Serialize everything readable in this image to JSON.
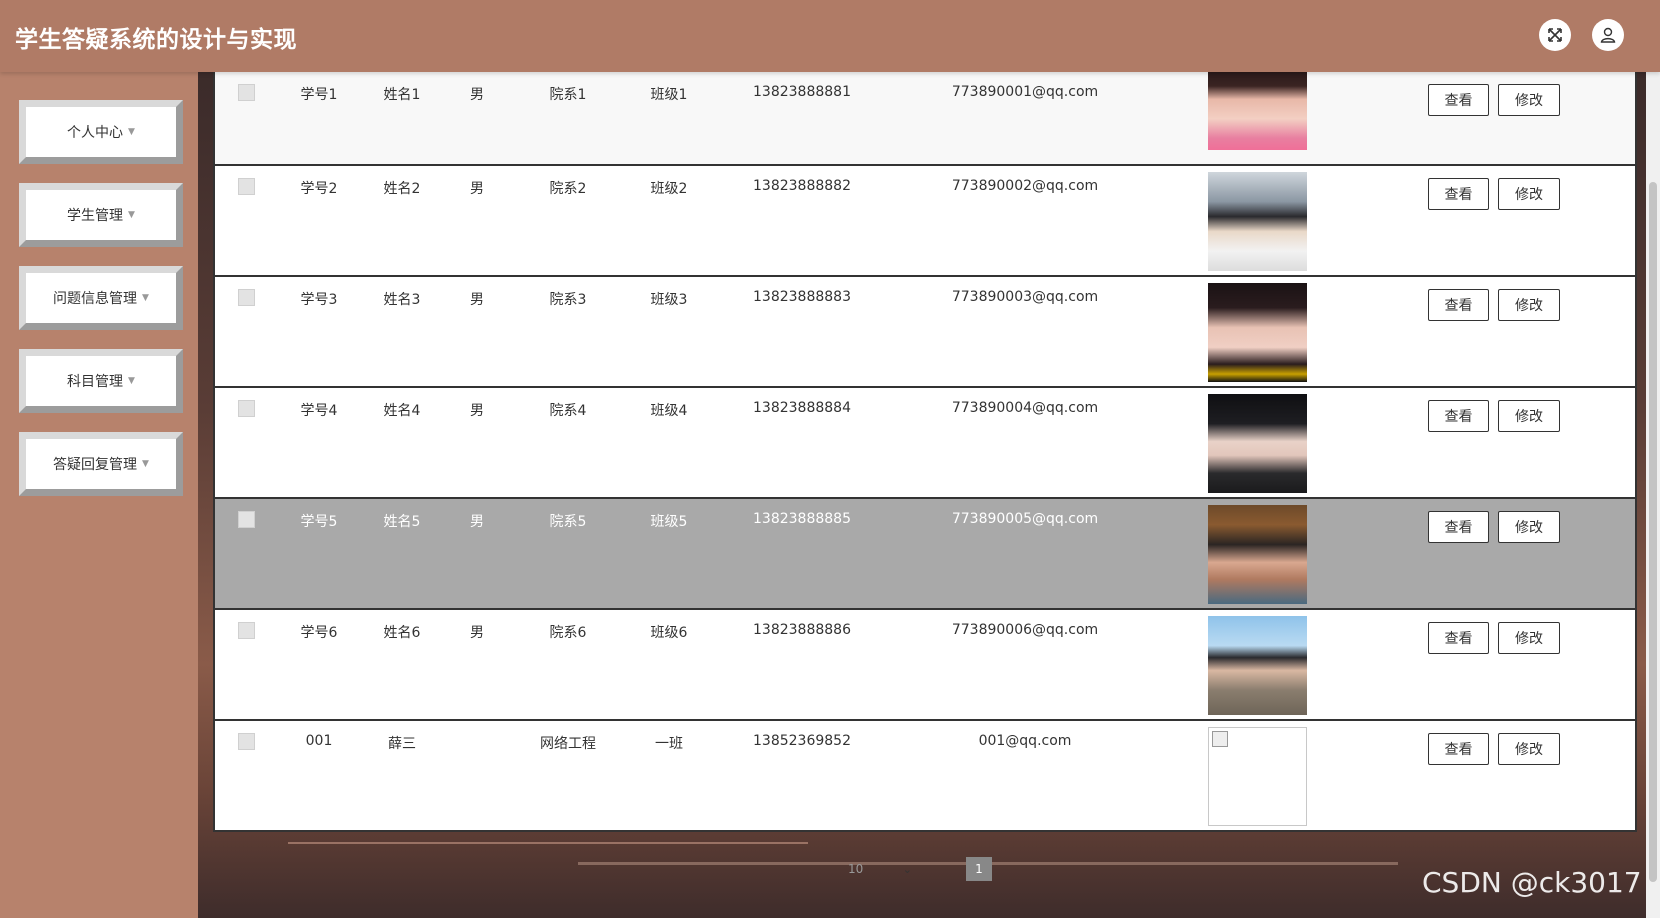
{
  "header": {
    "title": "学生答疑系统的设计与实现",
    "icons": [
      "fullscreen-icon",
      "user-icon"
    ]
  },
  "sidebar": {
    "items": [
      {
        "label": "个人中心"
      },
      {
        "label": "学生管理"
      },
      {
        "label": "问题信息管理"
      },
      {
        "label": "科目管理"
      },
      {
        "label": "答疑回复管理"
      }
    ]
  },
  "table": {
    "rows": [
      {
        "id": "学号1",
        "name": "姓名1",
        "gender": "男",
        "dept": "院系1",
        "class": "班级1",
        "phone": "13823888881",
        "email": "773890001@qq.com",
        "photo": "pink"
      },
      {
        "id": "学号2",
        "name": "姓名2",
        "gender": "男",
        "dept": "院系2",
        "class": "班级2",
        "phone": "13823888882",
        "email": "773890002@qq.com",
        "photo": "whale"
      },
      {
        "id": "学号3",
        "name": "姓名3",
        "gender": "男",
        "dept": "院系3",
        "class": "班级3",
        "phone": "13823888883",
        "email": "773890003@qq.com",
        "photo": "dark"
      },
      {
        "id": "学号4",
        "name": "姓名4",
        "gender": "男",
        "dept": "院系4",
        "class": "班级4",
        "phone": "13823888884",
        "email": "773890004@qq.com",
        "photo": "black"
      },
      {
        "id": "学号5",
        "name": "姓名5",
        "gender": "男",
        "dept": "院系5",
        "class": "班级5",
        "phone": "13823888885",
        "email": "773890005@qq.com",
        "photo": "hat"
      },
      {
        "id": "学号6",
        "name": "姓名6",
        "gender": "男",
        "dept": "院系6",
        "class": "班级6",
        "phone": "13823888886",
        "email": "773890006@qq.com",
        "photo": "sky"
      },
      {
        "id": "001",
        "name": "薛三",
        "gender": "",
        "dept": "网络工程",
        "class": "一班",
        "phone": "13852369852",
        "email": "001@qq.com",
        "photo": "broken"
      }
    ],
    "view_label": "查看",
    "edit_label": "修改"
  },
  "pagination": {
    "page_size": "10",
    "current_page": "1"
  },
  "watermark": "CSDN @ck3017"
}
